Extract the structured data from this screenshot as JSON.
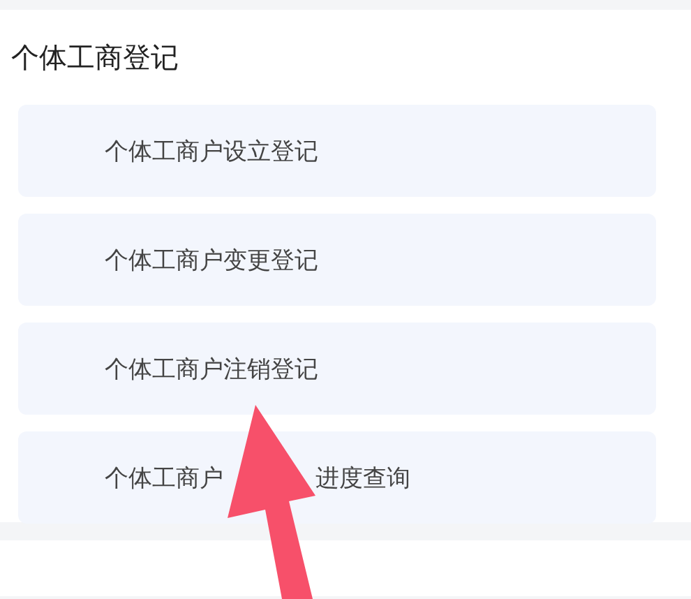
{
  "section": {
    "title": "个体工商登记"
  },
  "items": [
    {
      "label": "个体工商户设立登记"
    },
    {
      "label": "个体工商户变更登记"
    },
    {
      "label": "个体工商户注销登记"
    },
    {
      "label": "个体工商户",
      "label_after_arrow": "进度查询"
    }
  ]
}
